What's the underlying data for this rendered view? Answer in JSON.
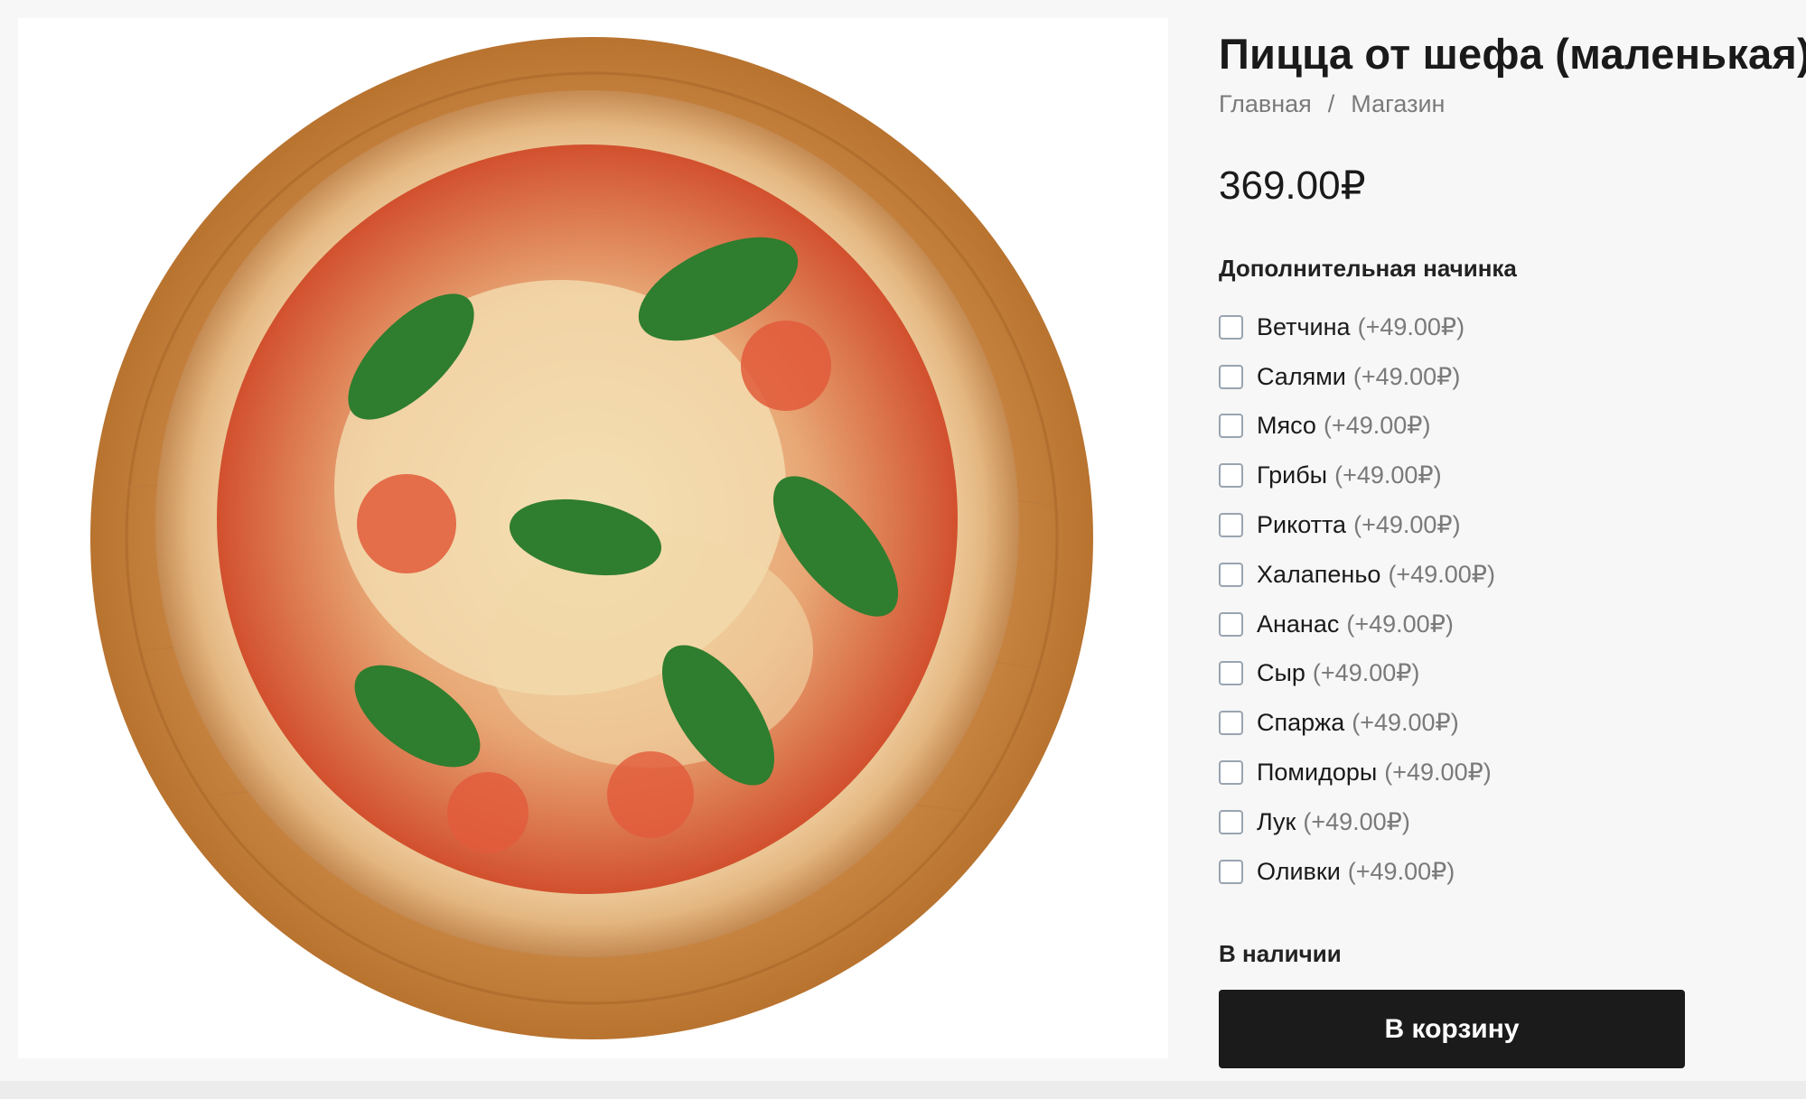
{
  "product": {
    "title": "Пицца от шефа (маленькая)",
    "price": "369.00₽",
    "image_alt": "pizza-photo"
  },
  "breadcrumb": {
    "home": "Главная",
    "separator": "/",
    "shop": "Магазин"
  },
  "addons": {
    "heading": "Дополнительная начинка",
    "items": [
      {
        "name": "Ветчина",
        "price": "(+49.00₽)"
      },
      {
        "name": "Салями",
        "price": "(+49.00₽)"
      },
      {
        "name": "Мясо",
        "price": "(+49.00₽)"
      },
      {
        "name": "Грибы",
        "price": "(+49.00₽)"
      },
      {
        "name": "Рикотта",
        "price": "(+49.00₽)"
      },
      {
        "name": "Халапеньо",
        "price": "(+49.00₽)"
      },
      {
        "name": "Ананас",
        "price": "(+49.00₽)"
      },
      {
        "name": "Сыр",
        "price": "(+49.00₽)"
      },
      {
        "name": "Спаржа",
        "price": "(+49.00₽)"
      },
      {
        "name": "Помидоры",
        "price": "(+49.00₽)"
      },
      {
        "name": "Лук",
        "price": "(+49.00₽)"
      },
      {
        "name": "Оливки",
        "price": "(+49.00₽)"
      }
    ]
  },
  "stock_status": "В наличии",
  "cart_button_label": "В корзину",
  "colors": {
    "page_bg": "#f7f7f7",
    "button_bg": "#1b1b1b",
    "button_text": "#ffffff",
    "muted_text": "#7a7a7a",
    "checkbox_border": "#9aa4b0"
  }
}
